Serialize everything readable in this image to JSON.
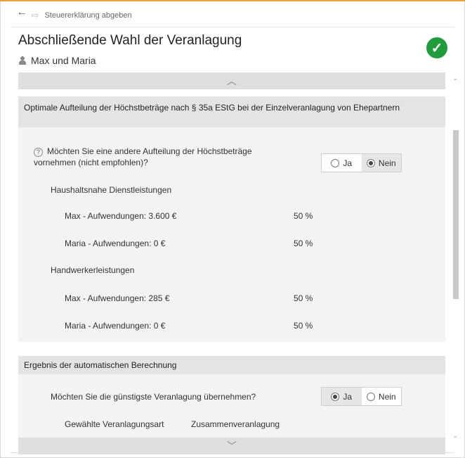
{
  "nav": {
    "back_icon": "arrow-left-icon",
    "forward_icon": "arrow-right-icon",
    "breadcrumb": "Steuererklärung abgeben"
  },
  "header": {
    "title": "Abschließende Wahl der Veranlagung",
    "person": "Max und Maria",
    "status_icon": "check-circle-icon",
    "status_color": "#1e9d3a"
  },
  "section1": {
    "title": "Optimale Aufteilung der Höchstbeträge nach § 35a EStG bei der Einzelveranlagung von Ehepartnern",
    "question": "Möchten Sie eine andere Aufteilung der Höchstbeträge vornehmen (nicht empfohlen)?",
    "option_yes": "Ja",
    "option_no": "Nein",
    "selected": "Nein",
    "groups": [
      {
        "label": "Haushaltsnahe Dienstleistungen",
        "rows": [
          {
            "label": "Max - Aufwendungen: 3.600 €",
            "value": "50 %"
          },
          {
            "label": "Maria - Aufwendungen: 0 €",
            "value": "50 %"
          }
        ]
      },
      {
        "label": "Handwerkerleistungen",
        "rows": [
          {
            "label": "Max - Aufwendungen: 285 €",
            "value": "50 %"
          },
          {
            "label": "Maria - Aufwendungen: 0 €",
            "value": "50 %"
          }
        ]
      }
    ]
  },
  "section2": {
    "title": "Ergebnis der automatischen Berechnung",
    "question": "Möchten Sie die günstigste Veranlagung übernehmen?",
    "option_yes": "Ja",
    "option_no": "Nein",
    "selected": "Ja",
    "result_label": "Gewählte Veranlagungsart",
    "result_value": "Zusammenveranlagung"
  }
}
